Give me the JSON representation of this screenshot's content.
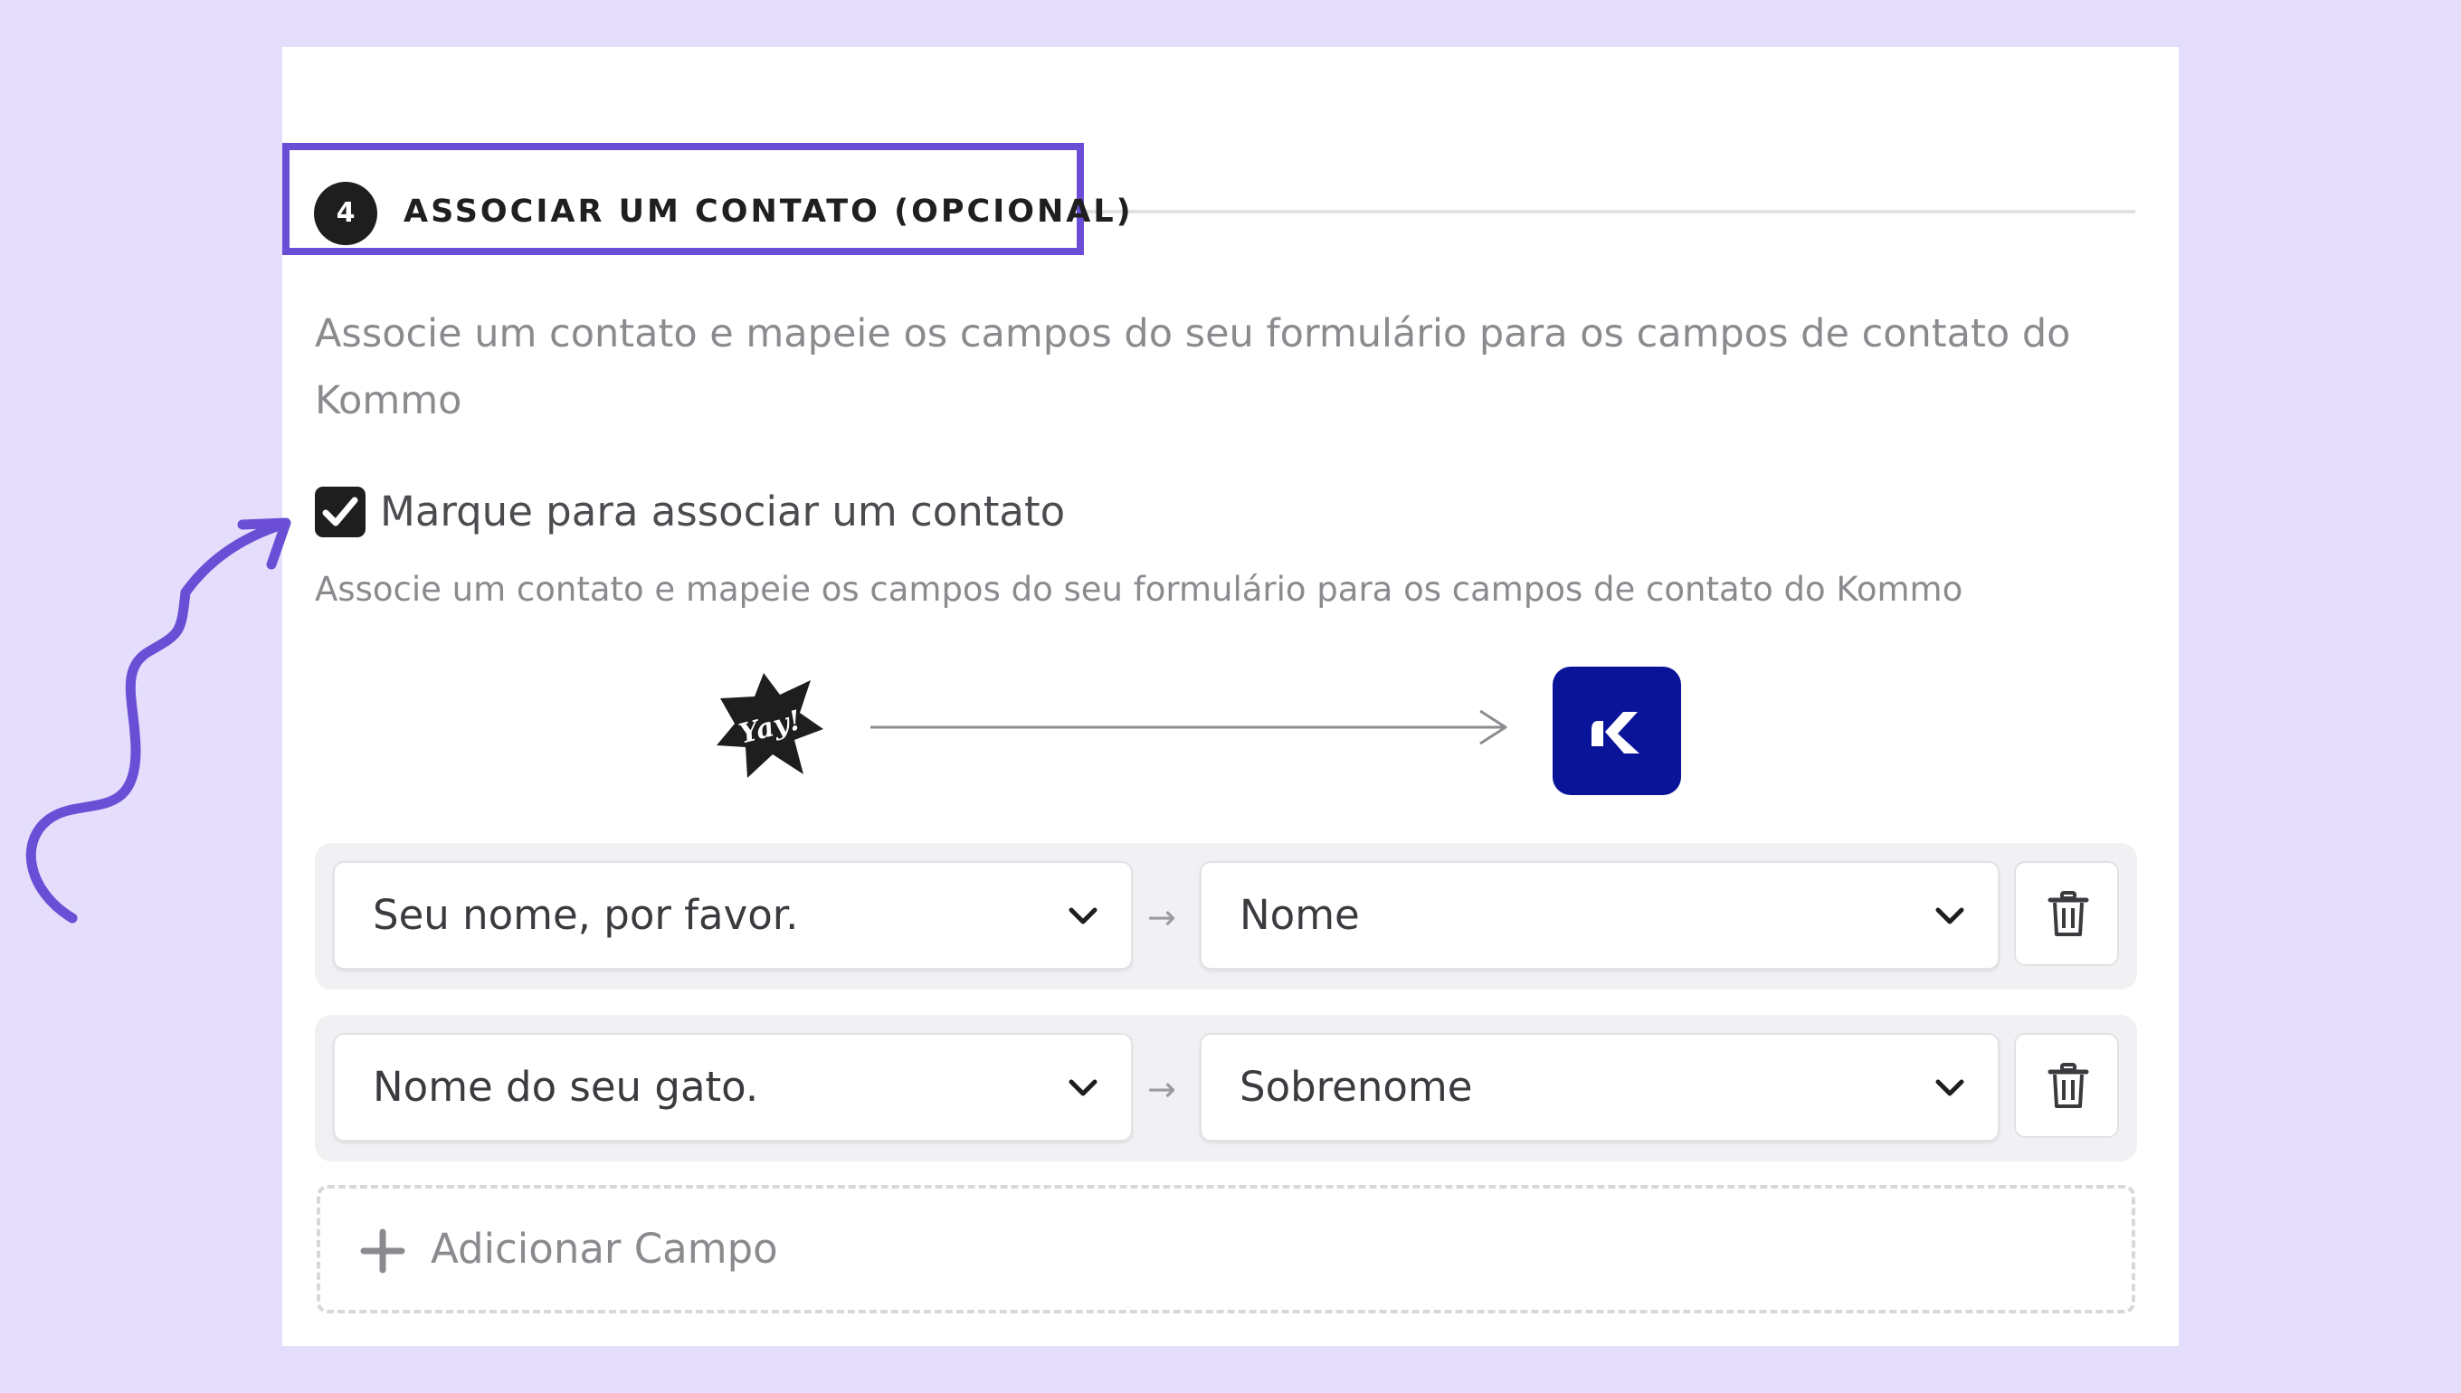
{
  "section": {
    "step_number": "4",
    "title": "ASSOCIAR UM CONTATO (OPCIONAL)",
    "description": "Associe um contato e mapeie os campos do seu formulário para os campos de contato do Kommo"
  },
  "associate_contact": {
    "checked": true,
    "label": "Marque para associar um contato",
    "helper": "Associe um contato e mapeie os campos do seu formulário para os campos de contato do Kommo"
  },
  "integration": {
    "source_logo_text": "Yay!",
    "source_icon": "yay-forms-logo",
    "target_icon": "kommo-logo"
  },
  "mappings": [
    {
      "source_field": "Seu nome, por favor.",
      "arrow": "→",
      "target_field": "Nome"
    },
    {
      "source_field": "Nome do seu gato.",
      "arrow": "→",
      "target_field": "Sobrenome"
    }
  ],
  "add_field": {
    "label": "Adicionar Campo"
  },
  "colors": {
    "background": "#e4defc",
    "highlight": "#6a4fd6",
    "kommo_brand": "#0a1499",
    "dark": "#1e1e1e"
  }
}
